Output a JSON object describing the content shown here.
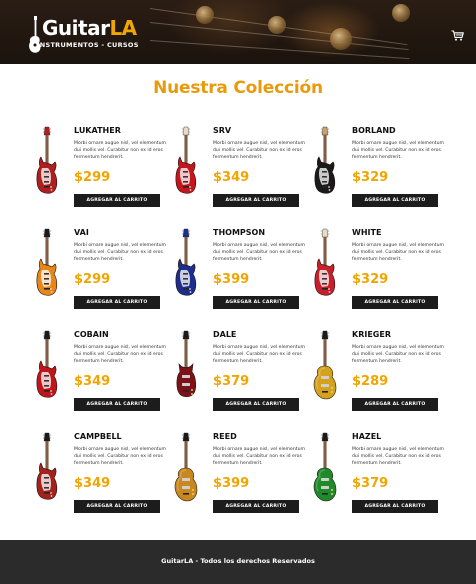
{
  "header": {
    "brand_main": "Guitar",
    "brand_accent": "LA",
    "brand_sub": "INSTRUMENTOS - CURSOS",
    "cart_icon": "cart-icon"
  },
  "main": {
    "title": "Nuestra Colección"
  },
  "products": [
    {
      "name": "LUKATHER",
      "description": "Morbi ornare augue nisl, vel elementum dui mollis vel. Curabitur non ex id eros fermentum hendrerit.",
      "price": "$299",
      "button": "AGREGAR AL CARRITO",
      "color": "#b01e1e",
      "kind": "strat",
      "headstock": "#b01e1e"
    },
    {
      "name": "SRV",
      "description": "Morbi ornare augue nisl, vel elementum dui mollis vel. Curabitur non ex id eros fermentum hendrerit.",
      "price": "$349",
      "button": "AGREGAR AL CARRITO",
      "color": "#c4161c",
      "kind": "strat",
      "headstock": "#e9dcc2"
    },
    {
      "name": "BORLAND",
      "description": "Morbi ornare augue nisl, vel elementum dui mollis vel. Curabitur non ex id eros fermentum hendrerit.",
      "price": "$329",
      "button": "AGREGAR AL CARRITO",
      "color": "#1a1a1a",
      "kind": "strat",
      "headstock": "#c8a06a"
    },
    {
      "name": "VAI",
      "description": "Morbi ornare augue nisl, vel elementum dui mollis vel. Curabitur non ex id eros fermentum hendrerit.",
      "price": "$299",
      "button": "AGREGAR AL CARRITO",
      "color": "#e8861a",
      "kind": "strat",
      "headstock": "#1a1a1a"
    },
    {
      "name": "THOMPSON",
      "description": "Morbi ornare augue nisl, vel elementum dui mollis vel. Curabitur non ex id eros fermentum hendrerit.",
      "price": "$399",
      "button": "AGREGAR AL CARRITO",
      "color": "#1d2f8c",
      "kind": "strat",
      "headstock": "#1d2f8c"
    },
    {
      "name": "WHITE",
      "description": "Morbi ornare augue nisl, vel elementum dui mollis vel. Curabitur non ex id eros fermentum hendrerit.",
      "price": "$329",
      "button": "AGREGAR AL CARRITO",
      "color": "#c8202a",
      "kind": "strat",
      "headstock": "#e9dcc2"
    },
    {
      "name": "COBAIN",
      "description": "Morbi ornare augue nisl, vel elementum dui mollis vel. Curabitur non ex id eros fermentum hendrerit.",
      "price": "$349",
      "button": "AGREGAR AL CARRITO",
      "color": "#c2151a",
      "kind": "strat",
      "headstock": "#1a1a1a"
    },
    {
      "name": "DALE",
      "description": "Morbi ornare augue nisl, vel elementum dui mollis vel. Curabitur non ex id eros fermentum hendrerit.",
      "price": "$379",
      "button": "AGREGAR AL CARRITO",
      "color": "#7a1218",
      "kind": "sg",
      "headstock": "#1a1a1a"
    },
    {
      "name": "KRIEGER",
      "description": "Morbi ornare augue nisl, vel elementum dui mollis vel. Curabitur non ex id eros fermentum hendrerit.",
      "price": "$289",
      "button": "AGREGAR AL CARRITO",
      "color": "#d4a21c",
      "kind": "lp",
      "headstock": "#1a1a1a"
    },
    {
      "name": "CAMPBELL",
      "description": "Morbi ornare augue nisl, vel elementum dui mollis vel. Curabitur non ex id eros fermentum hendrerit.",
      "price": "$349",
      "button": "AGREGAR AL CARRITO",
      "color": "#a3221c",
      "kind": "strat",
      "headstock": "#1a1a1a"
    },
    {
      "name": "REED",
      "description": "Morbi ornare augue nisl, vel elementum dui mollis vel. Curabitur non ex id eros fermentum hendrerit.",
      "price": "$399",
      "button": "AGREGAR AL CARRITO",
      "color": "#c9871f",
      "kind": "lp",
      "headstock": "#1a1a1a"
    },
    {
      "name": "HAZEL",
      "description": "Morbi ornare augue nisl, vel elementum dui mollis vel. Curabitur non ex id eros fermentum hendrerit.",
      "price": "$379",
      "button": "AGREGAR AL CARRITO",
      "color": "#1f8a2a",
      "kind": "lp",
      "headstock": "#1a1a1a"
    }
  ],
  "footer": {
    "text": "GuitarLA - Todos los derechos Reservados"
  },
  "colors": {
    "accent": "#f0a500",
    "title": "#e99a0b",
    "button_bg": "#1c1c1c",
    "footer_bg": "#2b2b2b"
  }
}
